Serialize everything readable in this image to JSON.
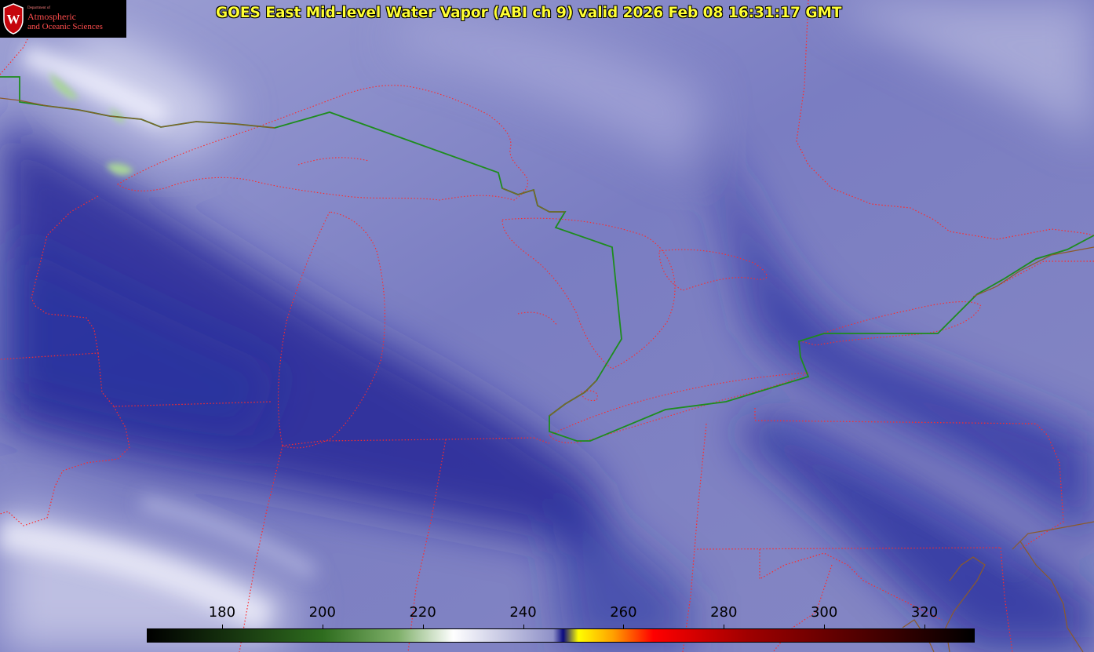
{
  "header": {
    "title": "GOES East Mid-level Water Vapor (ABI ch 9)  valid 2026 Feb 08 16:31:17 GMT"
  },
  "logo": {
    "dept": "Department of",
    "line1": "Atmospheric",
    "line2": "and Oceanic Sciences",
    "seal_letter": "W"
  },
  "colorbar": {
    "labels": [
      "180",
      "200",
      "220",
      "240",
      "260",
      "280",
      "300",
      "320"
    ],
    "values": [
      180,
      200,
      220,
      240,
      260,
      280,
      300,
      320
    ],
    "range": [
      180,
      330
    ],
    "stops": [
      {
        "v": 165,
        "c": "#000000"
      },
      {
        "v": 200,
        "c": "#2f6d1f"
      },
      {
        "v": 215,
        "c": "#7fb06a"
      },
      {
        "v": 226,
        "c": "#ffffff"
      },
      {
        "v": 246,
        "c": "#8f91c8"
      },
      {
        "v": 248,
        "c": "#0a0a80"
      },
      {
        "v": 251,
        "c": "#ffff00"
      },
      {
        "v": 258,
        "c": "#ffa000"
      },
      {
        "v": 266,
        "c": "#ff0000"
      },
      {
        "v": 285,
        "c": "#a00000"
      },
      {
        "v": 330,
        "c": "#000000"
      }
    ]
  },
  "colors": {
    "state_border": "#ff2a2a",
    "country_border": "#1e8c1e",
    "coastline": "#8b5a2b",
    "title": "#ffff33"
  }
}
